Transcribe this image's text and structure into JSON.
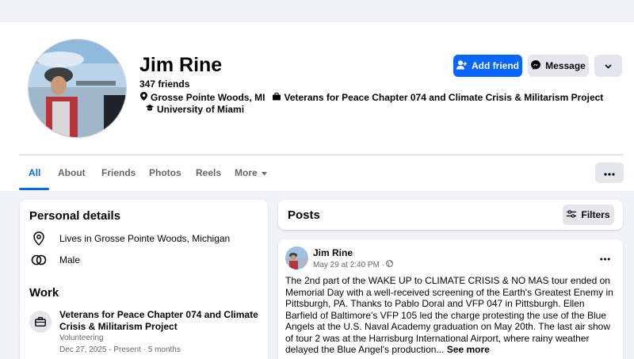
{
  "profile": {
    "name": "Jim Rine",
    "friends": "347 friends",
    "location": "Grosse Pointe Woods, MI",
    "work": "Veterans for Peace Chapter 074 and Climate Crisis & Militarism Project",
    "education": "University of Miami"
  },
  "actions": {
    "add_friend": "Add friend",
    "message": "Message"
  },
  "tabs": [
    {
      "label": "All"
    },
    {
      "label": "About"
    },
    {
      "label": "Friends"
    },
    {
      "label": "Photos"
    },
    {
      "label": "Reels"
    },
    {
      "label": "More"
    }
  ],
  "personal_details": {
    "title": "Personal details",
    "lives_in": "Lives in Grosse Pointe Woods, Michigan",
    "gender": "Male"
  },
  "work_section": {
    "title": "Work",
    "org": "Veterans for Peace Chapter 074 and Climate Crisis & Militarism Project",
    "role": "Volunteering",
    "dates": "Dec 27, 2025 - Present · 5 months"
  },
  "posts": {
    "title": "Posts",
    "filters": "Filters",
    "items": [
      {
        "author": "Jim Rine",
        "time": "May 29 at 2:40 PM · ",
        "text": "The 2nd part of the WAKE UP to CLIMATE CRISIS & NO MAS tour ended on Memorial Day with a well-received screening of the Earth's Greatest Enemy in Pittsburgh, PA. Thanks to Pablo Doral and VFP 047 in Pittsburgh. Ellen Barfield of Baltimore's VFP 105 led the charge protesting the use of the Blue Angels at the U.S. Naval Academy graduation on May 20th. The last air show of tour 2 was at the Harrisburg International Airport, where rainy weather delayed the Blue Angel's production... ",
        "see_more": "See more"
      }
    ]
  },
  "colors": {
    "accent": "#0866ff",
    "gray_button": "#e4e6eb",
    "page_bg": "#f0f2f5"
  }
}
